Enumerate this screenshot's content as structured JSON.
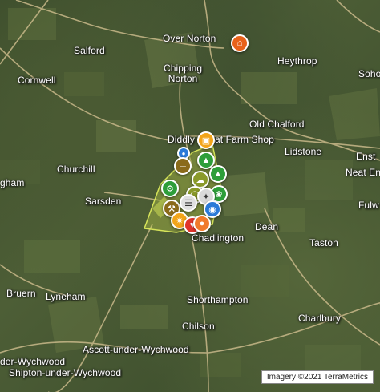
{
  "map": {
    "attribution": "Imagery ©2021 TerraMetrics",
    "places": [
      {
        "id": "over-norton",
        "label": "Over Norton"
      },
      {
        "id": "salford",
        "label": "Salford"
      },
      {
        "id": "heythrop",
        "label": "Heythrop"
      },
      {
        "id": "soho",
        "label": "Soho"
      },
      {
        "id": "chipping-norton",
        "label": "Chipping\nNorton"
      },
      {
        "id": "cornwell",
        "label": "Cornwell"
      },
      {
        "id": "old-chalford",
        "label": "Old Chalford"
      },
      {
        "id": "diddly-squat",
        "label": "Diddly Squat Farm Shop"
      },
      {
        "id": "lidstone",
        "label": "Lidstone"
      },
      {
        "id": "enstone",
        "label": "Enst"
      },
      {
        "id": "neat-enstone",
        "label": "Neat En"
      },
      {
        "id": "churchill",
        "label": "Churchill"
      },
      {
        "id": "gham",
        "label": "gham"
      },
      {
        "id": "sarsden",
        "label": "Sarsden"
      },
      {
        "id": "fulw",
        "label": "Fulw"
      },
      {
        "id": "dean",
        "label": "Dean"
      },
      {
        "id": "chadlington",
        "label": "Chadlington"
      },
      {
        "id": "taston",
        "label": "Taston"
      },
      {
        "id": "bruern",
        "label": "Bruern"
      },
      {
        "id": "lyneham",
        "label": "Lyneham"
      },
      {
        "id": "shorthampton",
        "label": "Shorthampton"
      },
      {
        "id": "chilson",
        "label": "Chilson"
      },
      {
        "id": "charlbury",
        "label": "Charlbury"
      },
      {
        "id": "ascott",
        "label": "Ascott-under-Wychwood"
      },
      {
        "id": "under-wychwood",
        "label": "der-Wychwood"
      },
      {
        "id": "shipton",
        "label": "Shipton-under-Wychwood"
      }
    ],
    "colors": {
      "home_marker": "#e8621a",
      "green_marker": "#2e9e3a",
      "olive_marker": "#8a9a2a",
      "orange_marker": "#f2a51a",
      "red_marker": "#e0342a",
      "blue_marker": "#2a7ad8",
      "field_fill": "#c8d84a",
      "road": "#c9b98a"
    },
    "markers": [
      {
        "id": "home",
        "icon": "home-icon",
        "color": "#e8621a"
      },
      {
        "id": "shop",
        "icon": "shop-icon",
        "color": "#f2a51a"
      },
      {
        "id": "m1",
        "icon": "person-icon",
        "color": "#2a7ad8"
      },
      {
        "id": "m2",
        "icon": "tree-icon",
        "color": "#2e9e3a"
      },
      {
        "id": "m3",
        "icon": "gate-icon",
        "color": "#8a6a1a"
      },
      {
        "id": "m4",
        "icon": "tree-icon",
        "color": "#2e9e3a"
      },
      {
        "id": "m5",
        "icon": "tractor-icon",
        "color": "#2e9e3a"
      },
      {
        "id": "m6",
        "icon": "sheep-icon",
        "color": "#8a9a2a"
      },
      {
        "id": "m7",
        "icon": "bicycle-icon",
        "color": "#8a9a2a"
      },
      {
        "id": "m8",
        "icon": "leaf-icon",
        "color": "#2e9e3a"
      },
      {
        "id": "m9",
        "icon": "hammer-icon",
        "color": "#8a6a1a"
      },
      {
        "id": "m10",
        "icon": "cow-icon",
        "color": "#e0e0e0"
      },
      {
        "id": "m11",
        "icon": "pig-icon",
        "color": "#e0342a"
      },
      {
        "id": "m12",
        "icon": "drop-icon",
        "color": "#2a7ad8"
      },
      {
        "id": "m13",
        "icon": "grain-icon",
        "color": "#f2a51a"
      },
      {
        "id": "m14",
        "icon": "fence-icon",
        "color": "#8a9a2a"
      }
    ]
  }
}
